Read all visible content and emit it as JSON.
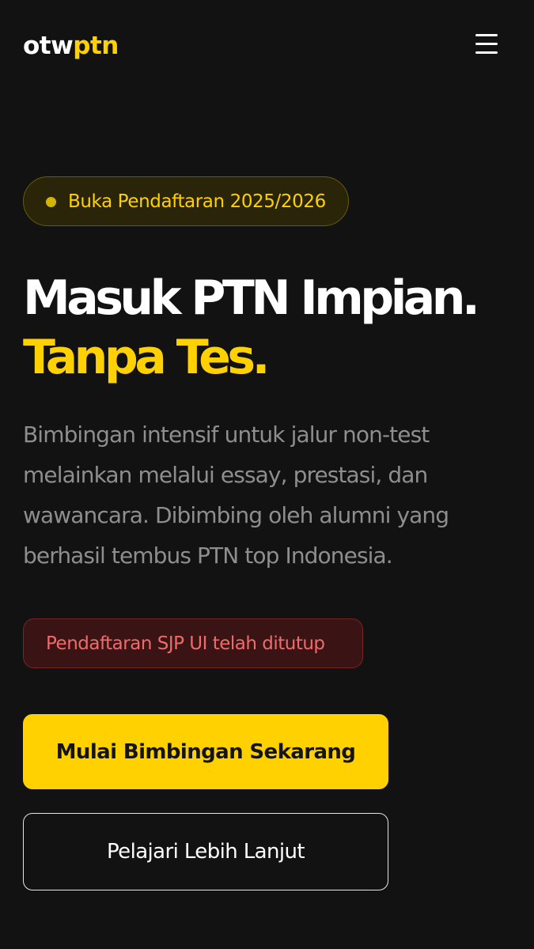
{
  "header": {
    "logo_part1": "otw",
    "logo_part2": "ptn",
    "menu_icon": "hamburger-menu-icon"
  },
  "hero": {
    "badge_text": "Buka Pendaftaran 2025/2026",
    "headline_line1": "Masuk PTN Impian.",
    "headline_line2": "Tanpa Tes.",
    "description": "Bimbingan intensif untuk jalur non-test melainkan melalui essay, prestasi, dan wawancara. Dibimbing oleh alumni yang berhasil tembus PTN top Indonesia.",
    "closed_notice": "Pendaftaran SJP UI telah ditutup",
    "primary_button": "Mulai Bimbingan Sekarang",
    "secondary_button": "Pelajari Lebih Lanjut"
  },
  "colors": {
    "background": "#121212",
    "accent": "#FFD100",
    "alert": "#f16a6a",
    "muted_text": "#8e8e8e"
  }
}
